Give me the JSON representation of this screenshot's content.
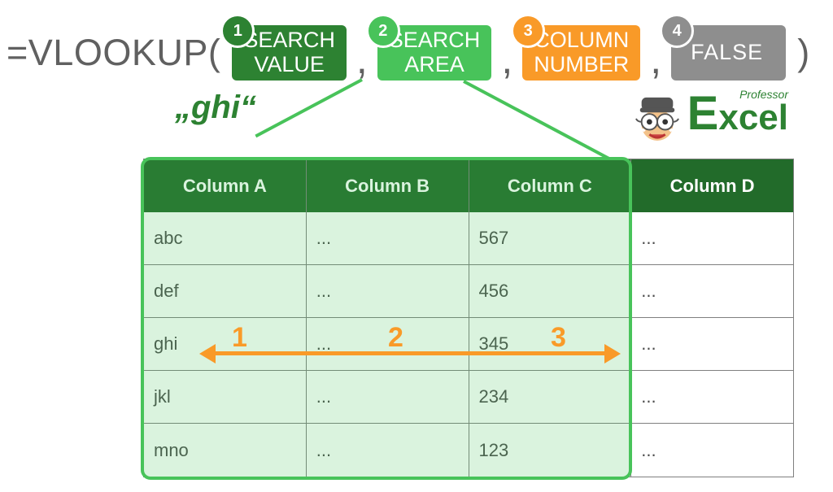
{
  "formula": {
    "prefix": "=VLOOKUP(",
    "suffix": ")",
    "comma": ",",
    "args": [
      {
        "badge": "1",
        "line1": "SEARCH",
        "line2": "VALUE"
      },
      {
        "badge": "2",
        "line1": "SEARCH",
        "line2": "AREA"
      },
      {
        "badge": "3",
        "line1": "COLUMN",
        "line2": "NUMBER"
      },
      {
        "badge": "4",
        "line1": "FALSE",
        "line2": ""
      }
    ]
  },
  "example_value": "„ghi“",
  "logo": {
    "small": "Professor",
    "big": "Excel"
  },
  "table": {
    "headers": [
      "Column A",
      "Column B",
      "Column C",
      "Column D"
    ],
    "rows": [
      [
        "abc",
        "...",
        "567",
        "..."
      ],
      [
        "def",
        "...",
        "456",
        "..."
      ],
      [
        "ghi",
        "...",
        "345",
        "..."
      ],
      [
        "jkl",
        "...",
        "234",
        "..."
      ],
      [
        "mno",
        "...",
        "123",
        "..."
      ]
    ]
  },
  "arrow_labels": [
    "1",
    "2",
    "3"
  ],
  "colors": {
    "search_value": "#2d8232",
    "search_area": "#48c35a",
    "column_number": "#f99a28",
    "false": "#8e8e8e",
    "table_header": "#226b2a"
  }
}
